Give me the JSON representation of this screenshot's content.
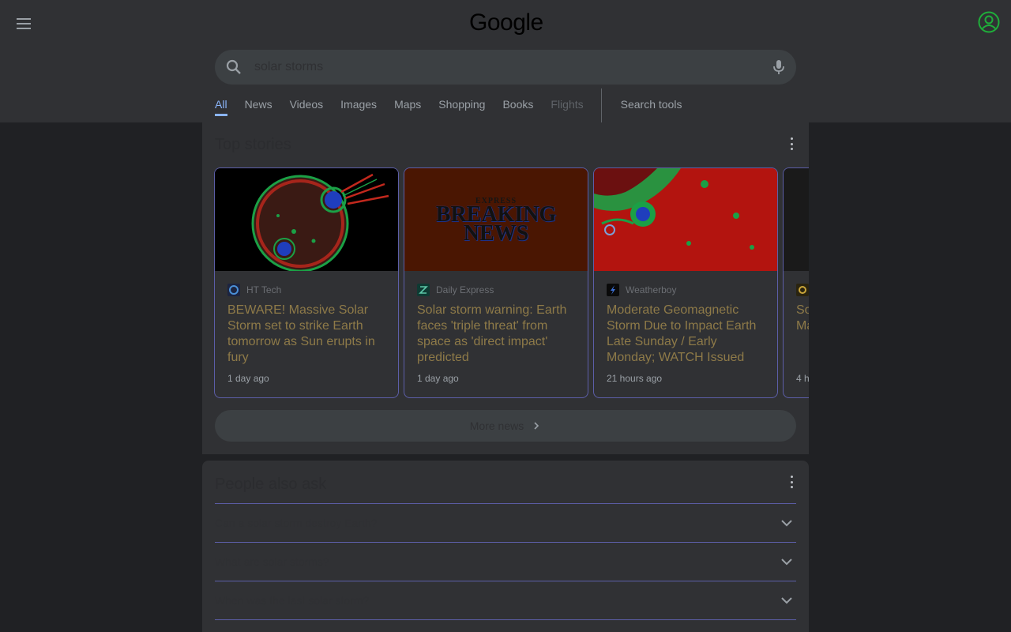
{
  "header": {
    "logo": "Google",
    "search_value": "solar storms"
  },
  "tabs": [
    {
      "label": "All"
    },
    {
      "label": "News"
    },
    {
      "label": "Videos"
    },
    {
      "label": "Images"
    },
    {
      "label": "Maps"
    },
    {
      "label": "Shopping"
    },
    {
      "label": "Books"
    },
    {
      "label": "Flights"
    }
  ],
  "search_tools": "Search tools",
  "top_stories": {
    "title": "Top stories",
    "cards": [
      {
        "source": "HT Tech",
        "headline": "BEWARE! Massive Solar Storm set to strike Earth tomorrow as Sun erupts in fury",
        "age": "1 day ago"
      },
      {
        "source": "Daily Express",
        "headline": "Solar storm warning: Earth faces 'triple threat' from space as 'direct impact' predicted",
        "age": "1 day ago",
        "thumb_brand": "EXPRESS",
        "thumb_line1": "BREAKING",
        "thumb_line2": "NEWS"
      },
      {
        "source": "Weatherboy",
        "headline": "Moderate Geomagnetic Storm Due to Impact Earth Late Sunday / Early Monday; WATCH Issued",
        "age": "21 hours ago"
      },
      {
        "source": "",
        "headline": "So\nMa",
        "age": "4 h"
      }
    ],
    "more_label": "More news"
  },
  "people_also_ask": {
    "title": "People also ask",
    "questions": [
      {
        "label": "Can a solar storm destroy Earth?"
      },
      {
        "label": "What are solar storms?"
      },
      {
        "label": "When was the last solar storm?"
      }
    ]
  }
}
